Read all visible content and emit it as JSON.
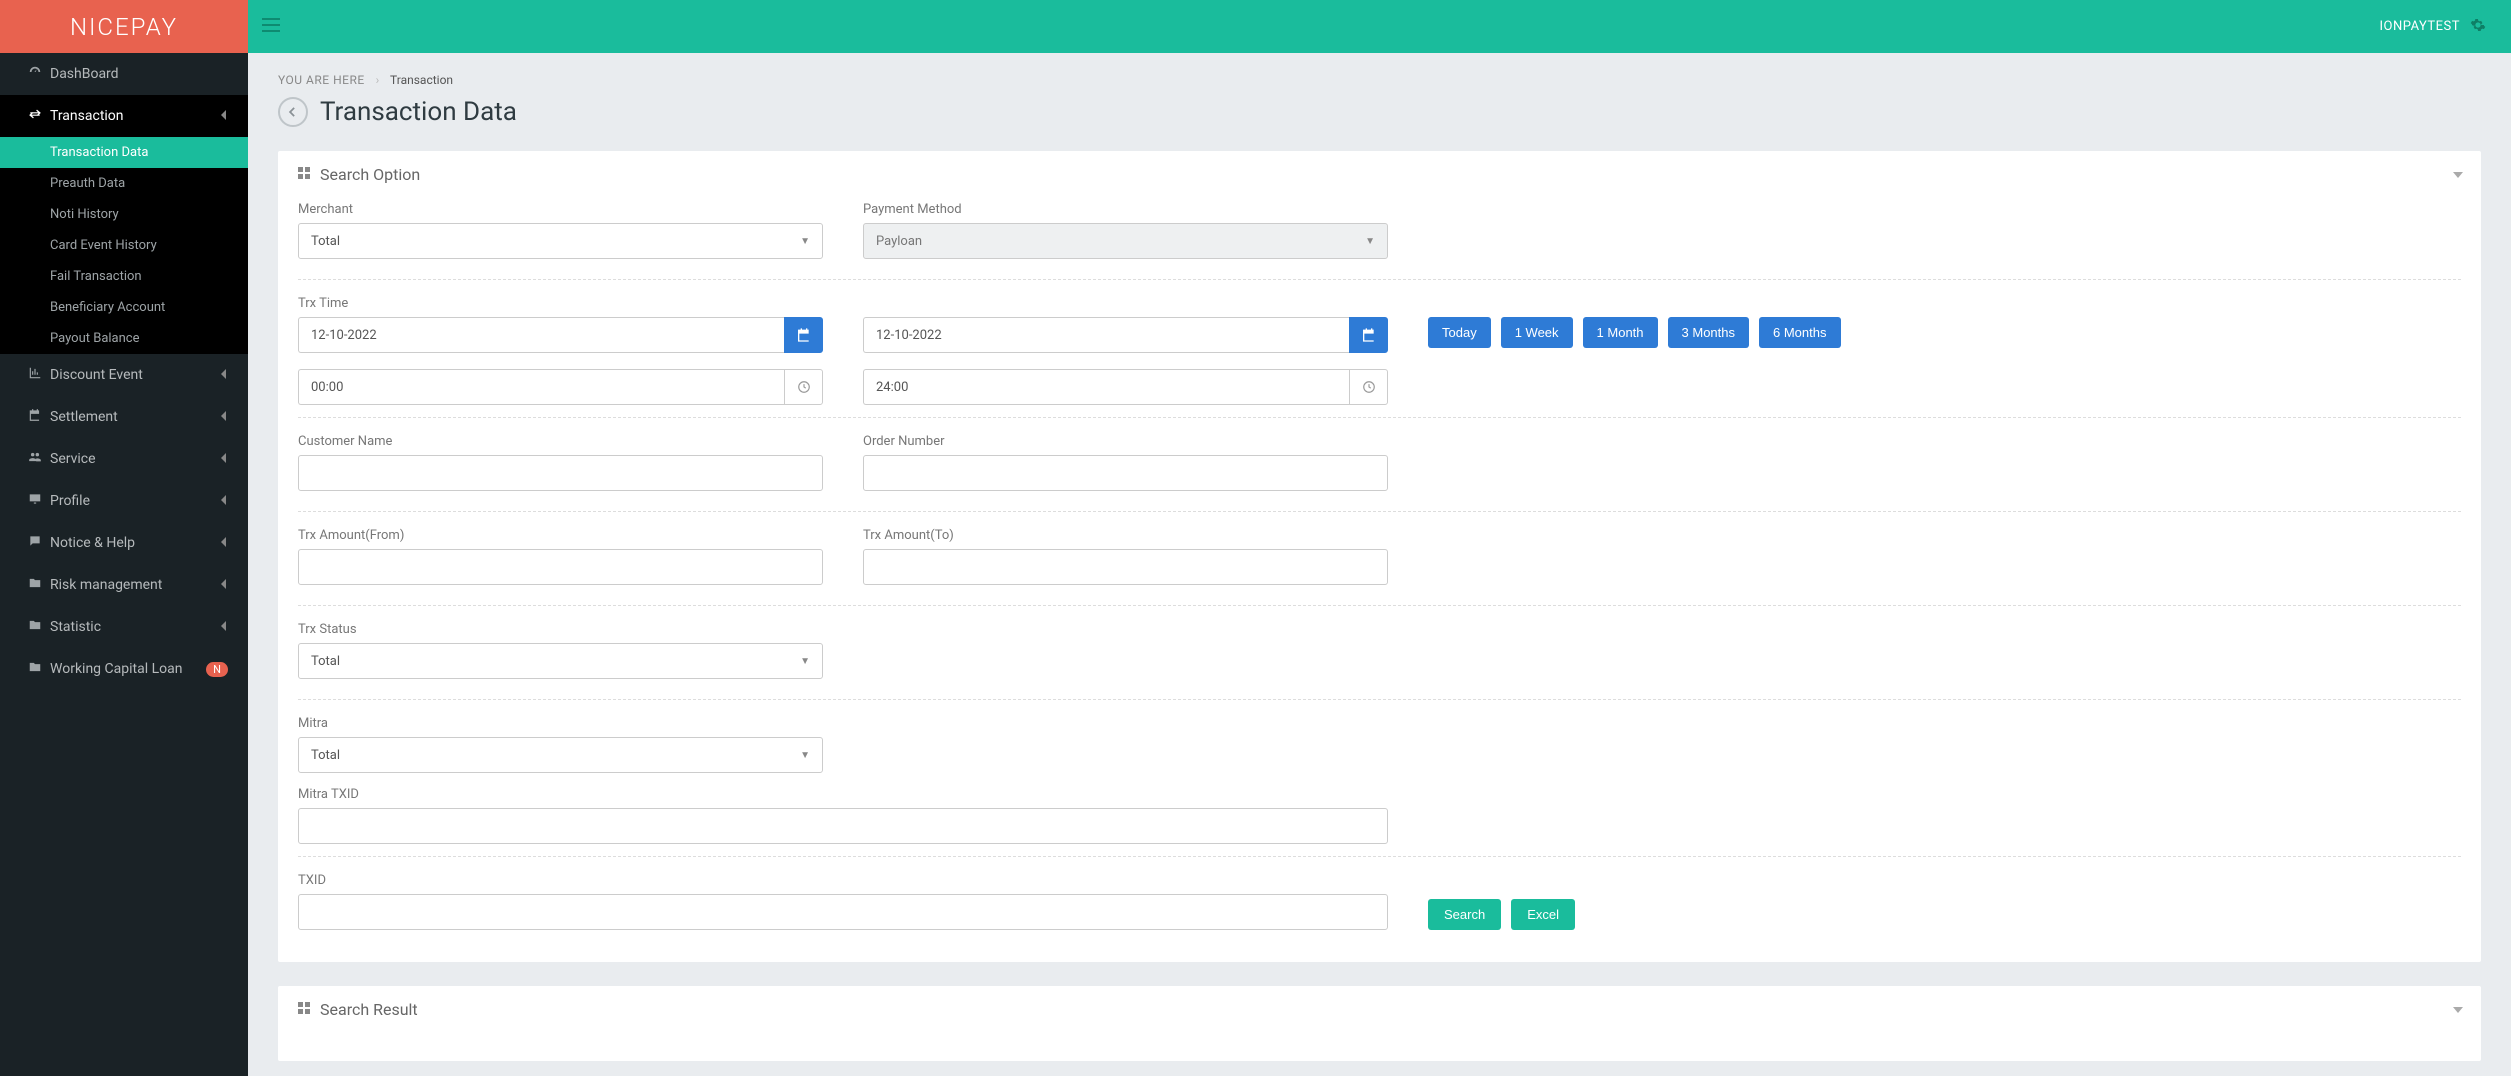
{
  "brand": "NICEPAY",
  "user": {
    "name": "IONPAYTEST"
  },
  "breadcrumb": {
    "here": "YOU ARE HERE",
    "current": "Transaction"
  },
  "page": {
    "title": "Transaction Data"
  },
  "sidebar": {
    "items": [
      {
        "label": "DashBoard",
        "icon": "dashboard"
      },
      {
        "label": "Transaction",
        "icon": "exchange",
        "expanded": true,
        "children": [
          {
            "label": "Transaction Data",
            "active": true
          },
          {
            "label": "Preauth Data"
          },
          {
            "label": "Noti History"
          },
          {
            "label": "Card Event History"
          },
          {
            "label": "Fail Transaction"
          },
          {
            "label": "Beneficiary Account"
          },
          {
            "label": "Payout Balance"
          }
        ]
      },
      {
        "label": "Discount Event",
        "icon": "chart"
      },
      {
        "label": "Settlement",
        "icon": "calendar"
      },
      {
        "label": "Service",
        "icon": "users"
      },
      {
        "label": "Profile",
        "icon": "monitor"
      },
      {
        "label": "Notice & Help",
        "icon": "comment"
      },
      {
        "label": "Risk management",
        "icon": "folder"
      },
      {
        "label": "Statistic",
        "icon": "folder"
      },
      {
        "label": "Working Capital Loan",
        "icon": "folder",
        "badge": "N"
      }
    ]
  },
  "panels": {
    "search_option": "Search Option",
    "search_result": "Search Result"
  },
  "form": {
    "merchant": {
      "label": "Merchant",
      "value": "Total"
    },
    "payment_method": {
      "label": "Payment Method",
      "value": "Payloan"
    },
    "trx_time": {
      "label": "Trx Time",
      "date_from": "12-10-2022",
      "date_to": "12-10-2022",
      "time_from": "00:00",
      "time_to": "24:00"
    },
    "presets": {
      "today": "Today",
      "week": "1 Week",
      "month": "1 Month",
      "months3": "3 Months",
      "months6": "6 Months"
    },
    "customer_name": {
      "label": "Customer Name",
      "value": ""
    },
    "order_number": {
      "label": "Order Number",
      "value": ""
    },
    "amount_from": {
      "label": "Trx Amount(From)",
      "value": ""
    },
    "amount_to": {
      "label": "Trx Amount(To)",
      "value": ""
    },
    "trx_status": {
      "label": "Trx Status",
      "value": "Total"
    },
    "mitra": {
      "label": "Mitra",
      "value": "Total"
    },
    "mitra_txid": {
      "label": "Mitra TXID",
      "value": ""
    },
    "txid": {
      "label": "TXID",
      "value": ""
    },
    "actions": {
      "search": "Search",
      "excel": "Excel"
    }
  }
}
